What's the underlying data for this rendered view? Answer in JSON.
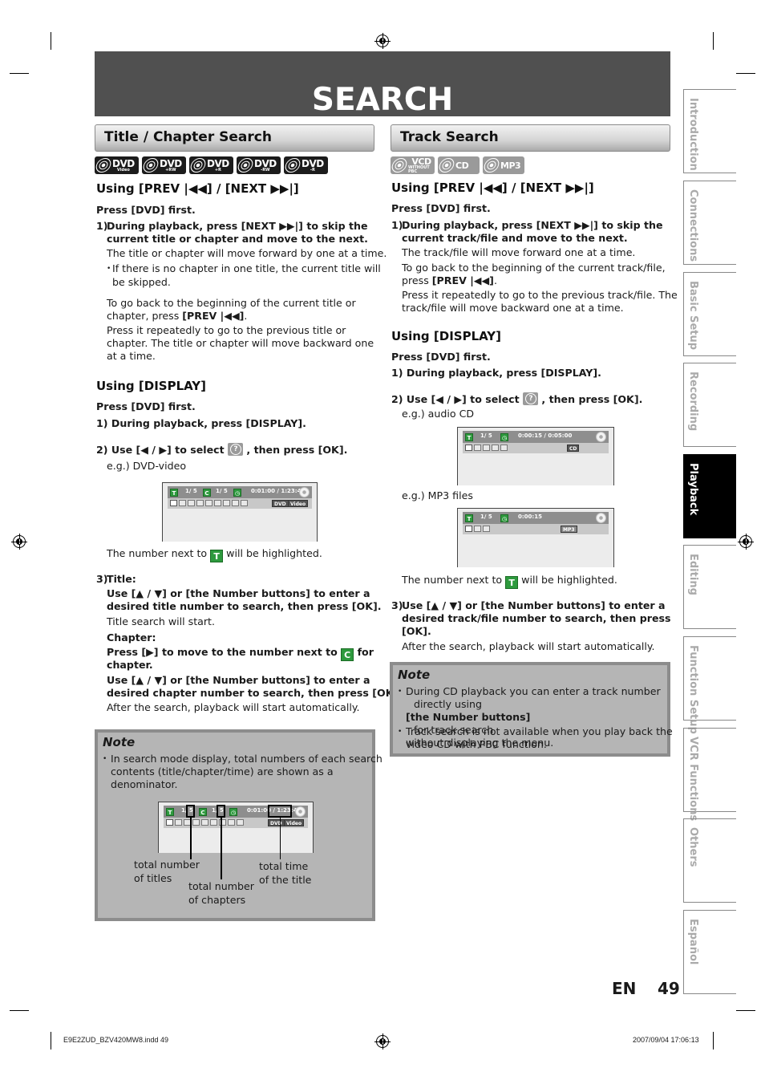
{
  "page": {
    "title": "SEARCH",
    "language": "EN",
    "page_number": "49",
    "footer_file": "E9E2ZUD_BZV420MW8.indd   49",
    "footer_timestamp": "2007/09/04   17:06:13"
  },
  "side_tabs": [
    {
      "label": "Introduction",
      "active": false
    },
    {
      "label": "Connections",
      "active": false
    },
    {
      "label": "Basic Setup",
      "active": false
    },
    {
      "label": "Recording",
      "active": false
    },
    {
      "label": "Playback",
      "active": true
    },
    {
      "label": "Editing",
      "active": false
    },
    {
      "label": "Function Setup",
      "active": false
    },
    {
      "label": "VCR Functions",
      "active": false
    },
    {
      "label": "Others",
      "active": false
    },
    {
      "label": "Español",
      "active": false
    }
  ],
  "left": {
    "section_title": "Title / Chapter Search",
    "discs": [
      {
        "name": "DVD",
        "sub": "Video"
      },
      {
        "name": "DVD",
        "sub": "+RW"
      },
      {
        "name": "DVD",
        "sub": "+R"
      },
      {
        "name": "DVD",
        "sub": "-RW"
      },
      {
        "name": "DVD",
        "sub": "-R"
      }
    ],
    "prevnext": {
      "heading": "Using [PREV |◀◀] / [NEXT ▶▶|]",
      "press_first": "Press [DVD] first.",
      "step1_num": "1)",
      "step1_line1": "During playback, press [NEXT ▶▶|] to skip the",
      "step1_line2": "current title or chapter and move to the next.",
      "p1": "The title or chapter will move forward by one at a time.",
      "bullet_line1": "If there is no chapter in one title, the current title will",
      "bullet_line2": "be skipped.",
      "p2_line1": "To go back to the beginning of the current title or",
      "p2_line2_pre": "chapter, press ",
      "p2_line2_bold": "[PREV |◀◀]",
      "p2_line2_post": ".",
      "p3_line1": "Press it repeatedly to go to the previous title or",
      "p3_line2": "chapter. The title or chapter will move backward one",
      "p3_line3": "at a time."
    },
    "display": {
      "heading": "Using [DISPLAY]",
      "press_first": "Press [DVD] first.",
      "step1": "1) During playback, press [DISPLAY].",
      "step2_pre": "2) Use [◀ / ▶] to select",
      "step2_post": ", then press [OK].",
      "example": "e.g.) DVD-video",
      "osd": {
        "t_label": "T",
        "title": "1/  5",
        "c_label": "C",
        "chapter": "1/  5",
        "time": "0:01:00 / 1:23:45",
        "tags": [
          "DVD",
          "Video"
        ]
      },
      "highlight_pre": "The number next to",
      "highlight_badge": "T",
      "highlight_post": "will be highlighted.",
      "step3_num": "3)",
      "step3_title_label": "Title:",
      "step3_title_line1": "Use [▲ / ▼] or [the Number buttons] to enter a",
      "step3_title_line2": "desired title number to search, then press [OK].",
      "step3_title_result": "Title search will start.",
      "step3_chapter_label": "Chapter:",
      "step3_chapter_line1_pre": "Press [▶] to move to the number next to",
      "step3_chapter_badge": "C",
      "step3_chapter_line1_post": "for",
      "step3_chapter_line2": "chapter.",
      "step3_chapter_line3": "Use [▲ / ▼] or [the Number buttons] to enter a",
      "step3_chapter_line4": "desired chapter number to search, then press [OK].",
      "step3_result": "After the search, playback will start automatically."
    },
    "note": {
      "title": "Note",
      "items": [
        [
          "In search mode display, total numbers of each search",
          "contents (title/chapter/time) are shown as a",
          "denominator."
        ]
      ],
      "osd": {
        "title": "1/  5",
        "chapter": "1/  5",
        "time": "0:01:00 / 1:23:45",
        "tags": [
          "DVD",
          "Video"
        ]
      },
      "annotations": {
        "titles": [
          "total number",
          "of titles"
        ],
        "chapters": [
          "total number",
          "of chapters"
        ],
        "time": [
          "total time",
          "of the title"
        ]
      }
    }
  },
  "right": {
    "section_title": "Track Search",
    "discs": [
      {
        "name": "VCD",
        "sub": "WITHOUT PBC"
      },
      {
        "name": "CD",
        "sub": ""
      },
      {
        "name": "MP3",
        "sub": ""
      }
    ],
    "prevnext": {
      "heading": "Using [PREV |◀◀] / [NEXT ▶▶|]",
      "press_first": "Press [DVD] first.",
      "step1_num": "1)",
      "step1_line1": "During playback, press [NEXT ▶▶|] to skip the",
      "step1_line2": "current track/file and move to the next.",
      "p1": "The track/file will move forward one at a time.",
      "p2_line1": "To go back to the beginning of the current track/file,",
      "p2_line2_pre": "press ",
      "p2_line2_bold": "[PREV |◀◀]",
      "p2_line2_post": ".",
      "p3_line1": "Press it repeatedly to go to the previous track/file. The",
      "p3_line2": "track/file will move backward one at a time."
    },
    "display": {
      "heading": "Using [DISPLAY]",
      "press_first": "Press [DVD] first.",
      "step1": "1) During playback, press [DISPLAY].",
      "step2_pre": "2) Use [◀ / ▶] to select",
      "step2_post": ", then press [OK].",
      "example_cd": "e.g.) audio CD",
      "osd_cd": {
        "t_label": "T",
        "track": "1/  5",
        "time": "0:00:15 / 0:05:00",
        "tag": "CD"
      },
      "example_mp3": "e.g.) MP3 files",
      "osd_mp3": {
        "t_label": "T",
        "track": "1/  5",
        "time": "0:00:15",
        "tag": "MP3"
      },
      "highlight_pre": "The number next to",
      "highlight_badge": "T",
      "highlight_post": "will be highlighted.",
      "step3_num": "3)",
      "step3_line1": "Use [▲ / ▼] or [the Number buttons] to enter a",
      "step3_line2": "desired track/file number to search, then press",
      "step3_line3": "[OK].",
      "step3_result": "After the search, playback will start automatically."
    },
    "note": {
      "title": "Note",
      "item1_line1": "During CD playback you can enter a track number",
      "item1_line2_pre": "directly using ",
      "item1_line2_bold": "[the Number buttons]",
      "item1_line2_post": " for track search",
      "item1_line3": "without displaying the menu.",
      "item2_line1": "Track search is not available when you play back the",
      "item2_line2": "video CD with PBC function."
    }
  }
}
